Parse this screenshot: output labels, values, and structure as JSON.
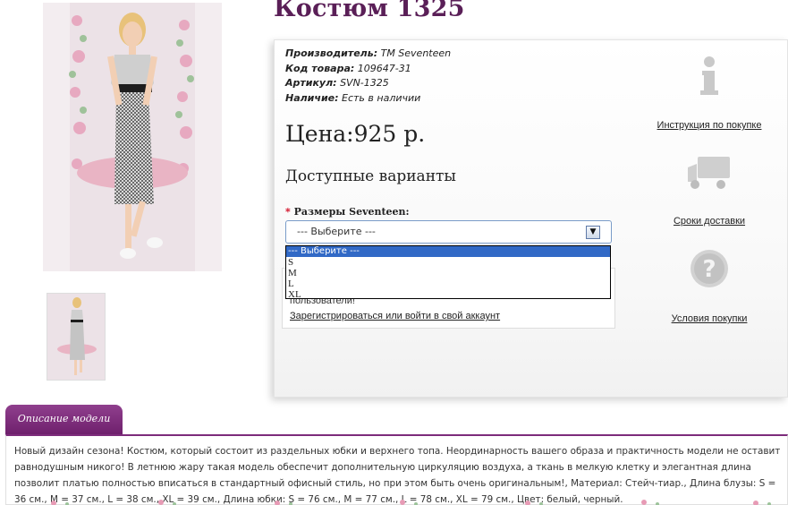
{
  "product": {
    "title": "Костюм 1325",
    "specs": [
      {
        "label": "Производитель:",
        "value": "ТМ Seventeen"
      },
      {
        "label": "Код товара:",
        "value": "109647-31"
      },
      {
        "label": "Артикул:",
        "value": "SVN-1325"
      },
      {
        "label": "Наличие:",
        "value": "Есть в наличии"
      }
    ],
    "price": "Цена:925 р.",
    "variants_heading": "Доступные варианты",
    "size_label": "Размеры Seventeen:",
    "size_required_mark": "*",
    "size_select": {
      "value": "--- Выберите ---",
      "options": [
        "--- Выберите ---",
        "S",
        "M",
        "L",
        "XL"
      ]
    },
    "login_prompt_text": "пользователи!",
    "login_link": "Зарегистрироваться или войти в свой аккаунт"
  },
  "side_links": {
    "instructions": "Инструкция по покупке",
    "delivery": "Сроки доставки",
    "conditions": "Условия покупки"
  },
  "description": {
    "tab_label": "Описание модели",
    "text": "Новый дизайн сезона! Костюм, который состоит из раздельных юбки и верхнего топа. Неординарность вашего образа и практичность модели не оставит равнодушным никого! В летнюю жару такая модель обеспечит дополнительную циркуляцию воздуха, а ткань в мелкую клетку и элегантная длина позволит платью полностью вписаться в стандартный офисный стиль, но при этом быть очень оригинальным!, Материал: Стейч-тиар., Длина блузы: S = 36 см., M = 37 см., L = 38 см., XL = 39 см., Длина юбки: S = 76 см., M = 77 см., L = 78 см., XL = 79 см., Цвет: белый, черный."
  },
  "colors": {
    "brand_purple": "#5a1f57",
    "tab_purple": "#7d2c7b",
    "select_highlight": "#3169c6"
  }
}
